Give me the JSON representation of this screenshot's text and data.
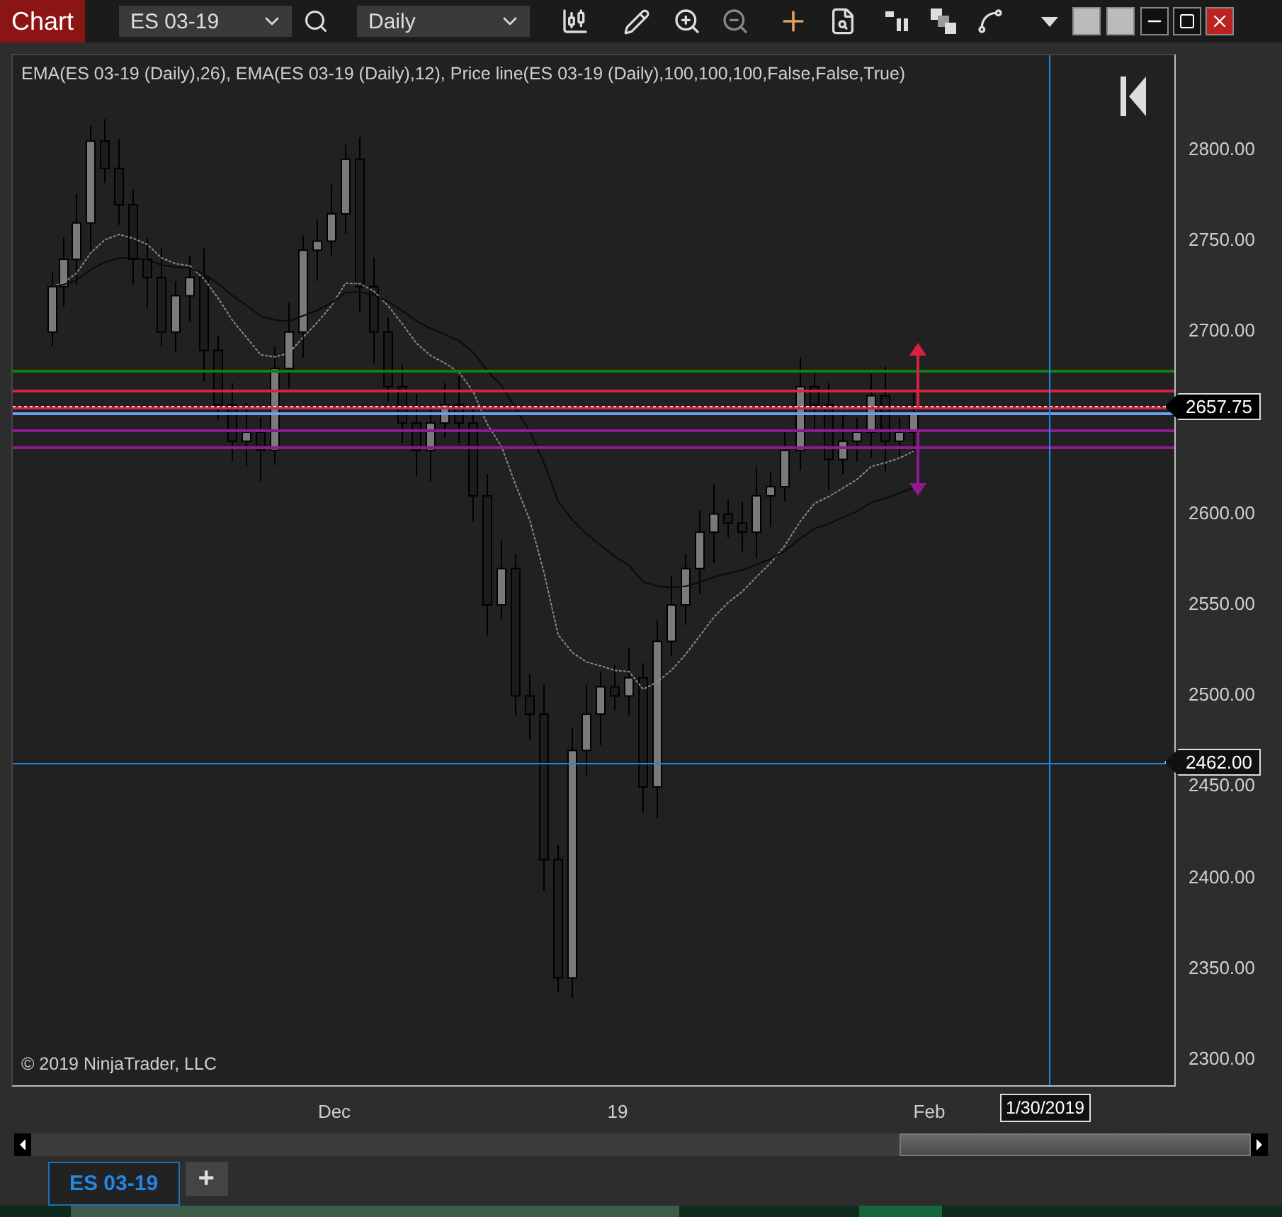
{
  "toolbar": {
    "title": "Chart",
    "instrument": "ES 03-19",
    "interval": "Daily"
  },
  "chart": {
    "indicator_label": "EMA(ES 03-19 (Daily),26), EMA(ES 03-19 (Daily),12), Price line(ES 03-19 (Daily),100,100,100,False,False,True)",
    "copyright": "© 2019 NinjaTrader, LLC",
    "price_ticks": [
      {
        "label": "2800.00"
      },
      {
        "label": "2750.00"
      },
      {
        "label": "2700.00"
      },
      {
        "label": "2600.00"
      },
      {
        "label": "2550.00"
      },
      {
        "label": "2500.00"
      },
      {
        "label": "2450.00"
      },
      {
        "label": "2400.00"
      },
      {
        "label": "2350.00"
      },
      {
        "label": "2300.00"
      }
    ],
    "last_price": "2657.75",
    "crosshair_price": "2462.00",
    "time_ticks": [
      {
        "label": "Dec"
      },
      {
        "label": "19"
      },
      {
        "label": "Feb"
      }
    ],
    "crosshair_date": "1/30/2019"
  },
  "tabs": [
    {
      "label": "ES 03-19",
      "selected": true
    }
  ],
  "add_tab": "+"
}
